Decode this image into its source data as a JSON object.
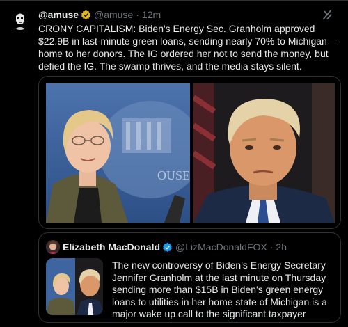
{
  "tweet": {
    "display_name": "@amuse",
    "handle": "@amuse",
    "separator": "·",
    "time": "12m",
    "text": "CRONY CAPITALISM: Biden's Energy Sec. Granholm approved $22.9B in last-minute green loans, sending nearly 70% to Michigan—home to her donors. The IG ordered her not to send the money, but defied the IG. The swamp thrives, and the media stays silent.",
    "image_text": "OUSE"
  },
  "quote": {
    "display_name": "Elizabeth MacDonald",
    "handle": "@LizMacDonaldFOX",
    "separator": "·",
    "time": "2h",
    "text": "The new controversy of Biden's Energy Secretary Jennifer Granholm at the last minute on Thursday sending more than $15B in Biden's green energy loans to utilities in her home state of Michigan is a major wake up call to the significant taxpayer abuses in the ..."
  },
  "colors": {
    "background": "#000000",
    "text": "#e7e9ea",
    "secondary": "#71767b",
    "verified_gold": "#e2b719",
    "verified_blue": "#1d9bf0",
    "border": "#2f3336"
  },
  "icons": [
    "avatar-stormtrooper",
    "gold-verified-badge",
    "grok-icon",
    "blue-verified-badge"
  ]
}
